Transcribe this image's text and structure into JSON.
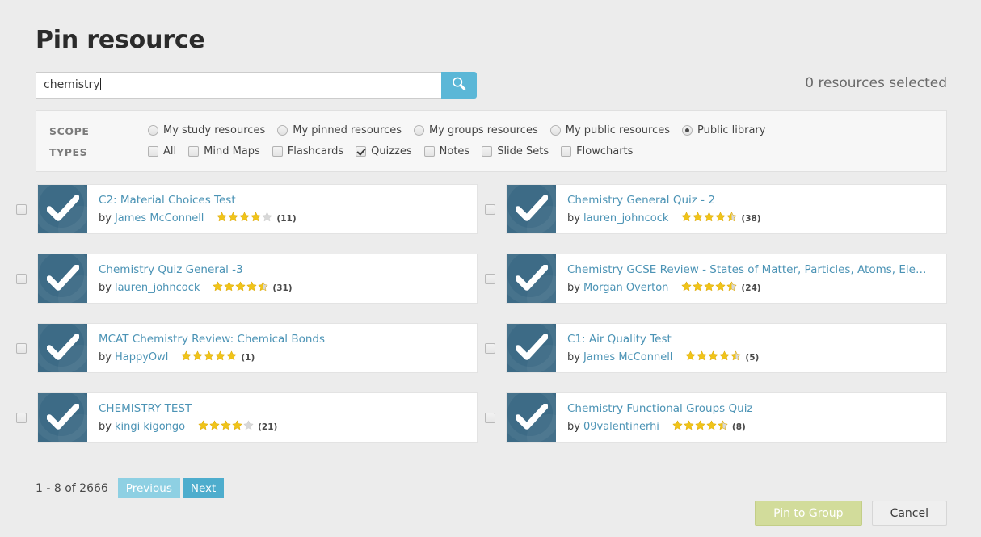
{
  "page_title": "Pin resource",
  "search": {
    "value": "chemistry",
    "button_icon": "search-icon",
    "selected_count_text": "0 resources selected"
  },
  "filters": {
    "scope_label": "SCOPE",
    "types_label": "TYPES",
    "scope_options": [
      {
        "label": "My study resources",
        "checked": false
      },
      {
        "label": "My pinned resources",
        "checked": false
      },
      {
        "label": "My groups resources",
        "checked": false
      },
      {
        "label": "My public resources",
        "checked": false
      },
      {
        "label": "Public library",
        "checked": true
      }
    ],
    "type_options": [
      {
        "label": "All",
        "checked": false
      },
      {
        "label": "Mind Maps",
        "checked": false
      },
      {
        "label": "Flashcards",
        "checked": false
      },
      {
        "label": "Quizzes",
        "checked": true
      },
      {
        "label": "Notes",
        "checked": false
      },
      {
        "label": "Slide Sets",
        "checked": false
      },
      {
        "label": "Flowcharts",
        "checked": false
      }
    ]
  },
  "results": {
    "by_word": "by",
    "items": [
      {
        "title": "C2: Material Choices Test",
        "author": "James McConnell",
        "rating": 4,
        "count": "(11)",
        "selected": false,
        "icon": "quiz-check-icon"
      },
      {
        "title": "Chemistry General Quiz - 2",
        "author": "lauren_johncock",
        "rating": 4.5,
        "count": "(38)",
        "selected": false,
        "icon": "quiz-check-icon"
      },
      {
        "title": "Chemistry Quiz General -3",
        "author": "lauren_johncock",
        "rating": 4.5,
        "count": "(31)",
        "selected": false,
        "icon": "quiz-check-icon"
      },
      {
        "title": "Chemistry GCSE Review - States of Matter, Particles, Atoms, Elements...",
        "author": "Morgan Overton",
        "rating": 4.5,
        "count": "(24)",
        "selected": false,
        "icon": "quiz-check-icon"
      },
      {
        "title": "MCAT Chemistry Review: Chemical Bonds",
        "author": "HappyOwl",
        "rating": 5,
        "count": "(1)",
        "selected": false,
        "icon": "quiz-check-icon"
      },
      {
        "title": "C1: Air Quality Test",
        "author": "James McConnell",
        "rating": 4.5,
        "count": "(5)",
        "selected": false,
        "icon": "quiz-check-icon"
      },
      {
        "title": "CHEMISTRY TEST",
        "author": "kingi kigongo",
        "rating": 4,
        "count": "(21)",
        "selected": false,
        "icon": "quiz-check-icon"
      },
      {
        "title": "Chemistry Functional Groups Quiz",
        "author": "09valentinerhi",
        "rating": 4.5,
        "count": "(8)",
        "selected": false,
        "icon": "quiz-check-icon"
      }
    ]
  },
  "pagination": {
    "range_text": "1 - 8 of 2666",
    "previous_label": "Previous",
    "next_label": "Next"
  },
  "actions": {
    "pin_label": "Pin to Group",
    "cancel_label": "Cancel"
  },
  "colors": {
    "accent_blue": "#5bb7d7",
    "link_blue": "#4b93b5",
    "thumb_blue": "#3d6b86",
    "star_gold": "#f0c419",
    "star_gray": "#d8d8d8",
    "pin_green": "#d2dc9b",
    "next_blue": "#4eadcd",
    "prev_blue": "#8ed0e3",
    "page_bg": "#ececec"
  }
}
